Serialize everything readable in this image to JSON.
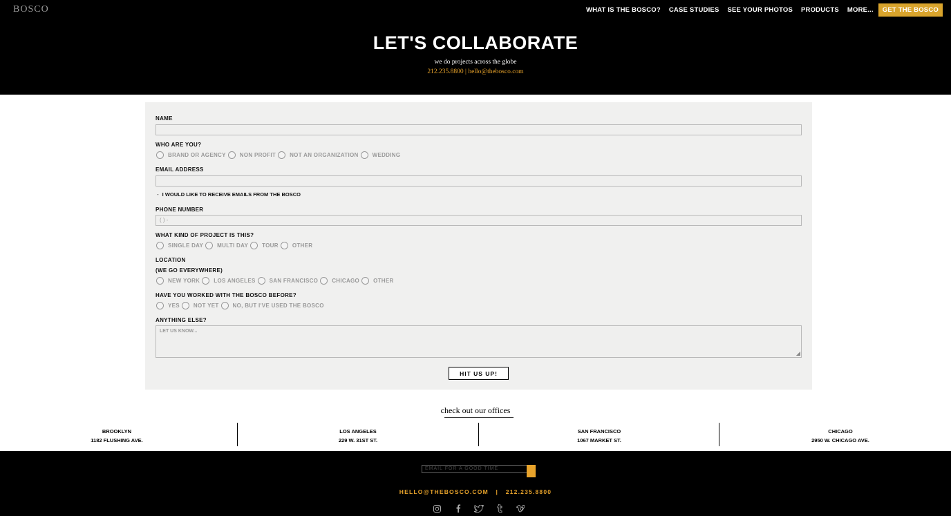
{
  "header": {
    "logo": "BOSCO",
    "nav": [
      {
        "label": "WHAT IS THE BOSCO?"
      },
      {
        "label": "CASE STUDIES"
      },
      {
        "label": "SEE YOUR PHOTOS"
      },
      {
        "label": "PRODUCTS"
      },
      {
        "label": "MORE..."
      }
    ],
    "cta": "GET THE BOSCO",
    "title": "LET'S COLLABORATE",
    "subtitle": "we do projects across the globe",
    "contact": "212.235.8800 | hello@thebosco.com"
  },
  "form": {
    "name_label": "NAME",
    "who_label": "WHO ARE YOU?",
    "who_options": [
      "BRAND OR AGENCY",
      "NON PROFIT",
      "NOT AN ORGANIZATION",
      "WEDDING"
    ],
    "email_label": "EMAIL ADDRESS",
    "newsletter_label": "I WOULD LIKE TO RECEIVE EMAILS FROM THE BOSCO",
    "phone_label": "PHONE NUMBER",
    "phone_placeholder": "(   )   -",
    "project_label": "WHAT KIND OF PROJECT IS THIS?",
    "project_options": [
      "SINGLE DAY",
      "MULTI DAY",
      "TOUR",
      "OTHER"
    ],
    "location_label": "LOCATION",
    "location_sub": "(WE GO EVERYWHERE)",
    "location_options": [
      "NEW YORK",
      "LOS ANGELES",
      "SAN FRANCISCO",
      "CHICAGO",
      "OTHER"
    ],
    "worked_label": "HAVE YOU WORKED WITH THE BOSCO BEFORE?",
    "worked_options": [
      "YES",
      "NOT YET",
      "NO, BUT I'VE USED THE BOSCO"
    ],
    "else_label": "ANYTHING ELSE?",
    "else_placeholder": "LET US KNOW...",
    "submit": "HIT US UP!"
  },
  "offices": {
    "title": "check out our offices",
    "items": [
      {
        "city": "BROOKLYN",
        "address": "1182 FLUSHING AVE."
      },
      {
        "city": "LOS ANGELES",
        "address": "229 W. 31ST ST."
      },
      {
        "city": "SAN FRANCISCO",
        "address": "1067 MARKET ST."
      },
      {
        "city": "CHICAGO",
        "address": "2950 W. CHICAGO AVE."
      }
    ]
  },
  "footer": {
    "email_placeholder": "EMAIL FOR A GOOD TIME",
    "contact": "HELLO@THEBOSCO.COM   |   212.235.8800",
    "socials": [
      "instagram-icon",
      "facebook-icon",
      "twitter-icon",
      "tumblr-icon",
      "vimeo-icon"
    ]
  },
  "colors": {
    "accent": "#e8a32b",
    "cta": "#d9a42c",
    "form_bg": "#f0f0ef"
  }
}
